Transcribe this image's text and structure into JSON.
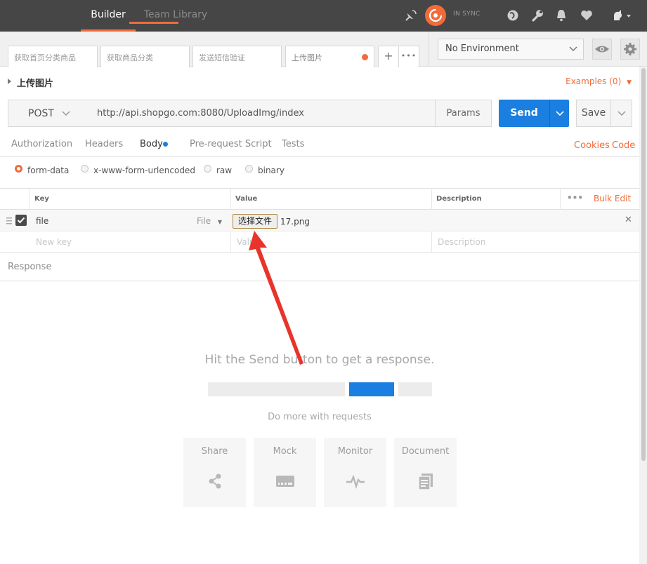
{
  "topbar": {
    "tabs": [
      {
        "label": "Builder",
        "active": true
      },
      {
        "label": "Team Library",
        "active": false
      }
    ],
    "sync_status": "IN SYNC",
    "icons": [
      "satellite-icon",
      "sync-icon",
      "globe-icon",
      "wrench-icon",
      "bell-icon",
      "heart-icon",
      "user-icon"
    ]
  },
  "request_tabs": [
    {
      "label": "获取首页分类商品"
    },
    {
      "label": "获取商品分类"
    },
    {
      "label": "发送短信验证"
    },
    {
      "label": "上传图片",
      "active": true,
      "unsaved": true
    }
  ],
  "request_tab_actions": {
    "add": "+",
    "more": "•••"
  },
  "environment": {
    "selected": "No Environment"
  },
  "request": {
    "name": "上传图片",
    "examples_label": "Examples (0)",
    "method": "POST",
    "url": "http://api.shopgo.com:8080/UploadImg/index",
    "params_label": "Params",
    "send_label": "Send",
    "save_label": "Save"
  },
  "subtabs": [
    {
      "label": "Authorization"
    },
    {
      "label": "Headers"
    },
    {
      "label": "Body",
      "active": true
    },
    {
      "label": "Pre-request Script"
    },
    {
      "label": "Tests"
    }
  ],
  "links": {
    "cookies": "Cookies",
    "code": "Code"
  },
  "body_types": [
    {
      "label": "form-data",
      "selected": true
    },
    {
      "label": "x-www-form-urlencoded",
      "selected": false
    },
    {
      "label": "raw",
      "selected": false
    },
    {
      "label": "binary",
      "selected": false
    }
  ],
  "kv_table": {
    "headers": {
      "key": "Key",
      "value": "Value",
      "description": "Description",
      "more": "•••",
      "bulk_edit": "Bulk Edit"
    },
    "rows": [
      {
        "key": "file",
        "type": "File",
        "choose_button": "选择文件",
        "file_name": "17.png",
        "checked": true
      }
    ],
    "placeholders": {
      "key": "New key",
      "value": "Value",
      "description": "Description"
    }
  },
  "response": {
    "label": "Response",
    "hint": "Hit the Send button to get a response.",
    "do_more": "Do more with requests",
    "cards": [
      {
        "label": "Share",
        "icon": "share-icon"
      },
      {
        "label": "Mock",
        "icon": "mock-server-icon"
      },
      {
        "label": "Monitor",
        "icon": "monitor-pulse-icon"
      },
      {
        "label": "Document",
        "icon": "document-icon"
      }
    ]
  },
  "colors": {
    "accent": "#f26b3a",
    "send_blue": "#1a7fe0",
    "topbar": "#464646",
    "annotation_arrow": "#e8342a"
  }
}
